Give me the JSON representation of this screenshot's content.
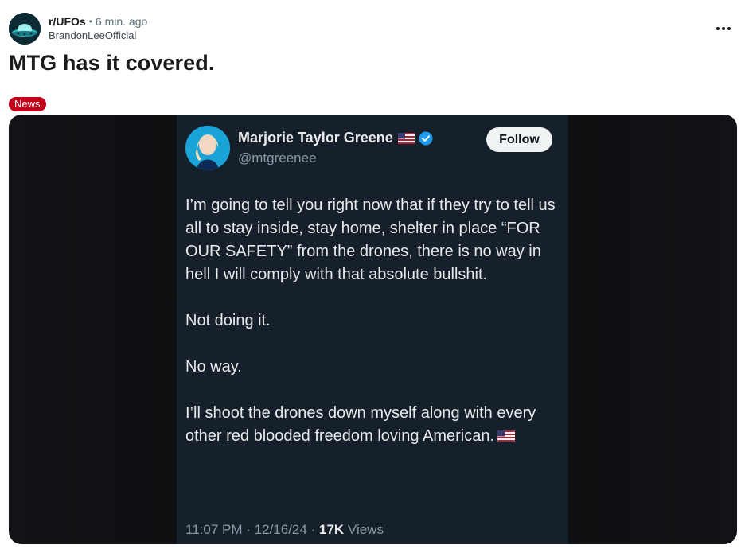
{
  "post": {
    "subreddit": "r/UFOs",
    "separator": "•",
    "time_ago": "6 min. ago",
    "author": "BrandonLeeOfficial",
    "title": "MTG has it covered.",
    "flair": "News",
    "more_icon": "more-horizontal-icon"
  },
  "tweet": {
    "name": "Marjorie Taylor Greene",
    "handle": "@mtgreenee",
    "follow_label": "Follow",
    "paragraphs": [
      "I’m going to tell you right now that if they try to tell us all to stay inside, stay home, shelter in place “FOR OUR SAFETY” from the drones, there is no way in hell I will comply with that absolute bullshit.",
      "Not doing it.",
      "No way.",
      "I’ll shoot the drones down myself along with every other red blooded freedom loving American."
    ],
    "time": "11:07 PM",
    "date": "12/16/24",
    "dot": "·",
    "views_count": "17K",
    "views_label": "Views"
  },
  "colors": {
    "flair_bg": "#c4001a",
    "tweet_bg": "#15202b",
    "verified": "#1d9bf0"
  }
}
